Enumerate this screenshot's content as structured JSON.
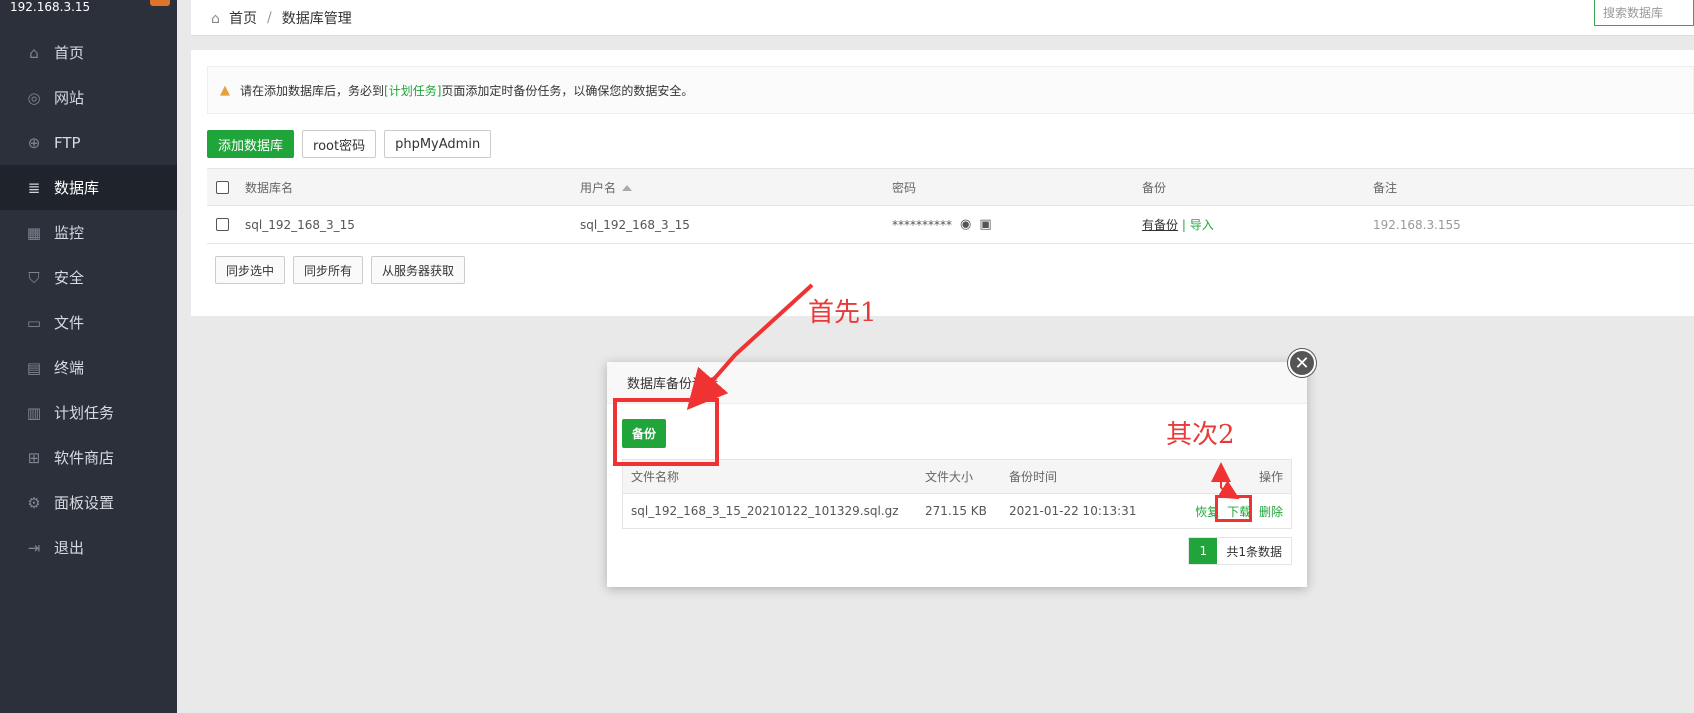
{
  "sidebar": {
    "brand": "192.168.3.15",
    "items": [
      {
        "label": "首页",
        "icon": "home-icon"
      },
      {
        "label": "网站",
        "icon": "globe-icon"
      },
      {
        "label": "FTP",
        "icon": "ftp-icon"
      },
      {
        "label": "数据库",
        "icon": "database-icon",
        "active": true
      },
      {
        "label": "监控",
        "icon": "monitor-icon"
      },
      {
        "label": "安全",
        "icon": "shield-icon"
      },
      {
        "label": "文件",
        "icon": "folder-icon"
      },
      {
        "label": "终端",
        "icon": "terminal-icon"
      },
      {
        "label": "计划任务",
        "icon": "calendar-icon"
      },
      {
        "label": "软件商店",
        "icon": "apps-icon"
      },
      {
        "label": "面板设置",
        "icon": "gear-icon"
      },
      {
        "label": "退出",
        "icon": "logout-icon"
      }
    ]
  },
  "breadcrumb": {
    "home": "首页",
    "sep": "/",
    "current": "数据库管理"
  },
  "search": {
    "placeholder": "搜索数据库"
  },
  "alert": {
    "prefix": "请在添加数据库后，务必到",
    "link": "[计划任务]",
    "suffix": "页面添加定时备份任务，以确保您的数据安全。"
  },
  "toolbar": {
    "add_db": "添加数据库",
    "root_pwd": "root密码",
    "phpmyadmin": "phpMyAdmin"
  },
  "db_table": {
    "headers": {
      "name": "数据库名",
      "user": "用户名",
      "password": "密码",
      "backup": "备份",
      "note": "备注"
    },
    "rows": [
      {
        "name": "sql_192_168_3_15",
        "user": "sql_192_168_3_15",
        "password": "**********",
        "backup_link": "有备份",
        "backup_sep": "|",
        "import": "导入",
        "note": "192.168.3.155"
      }
    ]
  },
  "sync": {
    "selected": "同步选中",
    "all": "同步所有",
    "from_server": "从服务器获取"
  },
  "dialog": {
    "title": "数据库备份详情",
    "close": "✕",
    "backup_button": "备份",
    "headers": {
      "file": "文件名称",
      "size": "文件大小",
      "time": "备份时间",
      "action": "操作"
    },
    "rows": [
      {
        "file": "sql_192_168_3_15_20210122_101329.sql.gz",
        "size": "271.15 KB",
        "time": "2021-01-22 10:13:31",
        "restore": "恢复",
        "download": "下载",
        "delete": "删除"
      }
    ],
    "pager": {
      "page": "1",
      "total": "共1条数据"
    }
  },
  "annotations": {
    "first": "首先1",
    "second": "其次2",
    "color": "#e83a3a"
  },
  "colors": {
    "sidebar_bg": "#2b303b",
    "accent": "#20a53a",
    "warning": "#e4a23c"
  }
}
